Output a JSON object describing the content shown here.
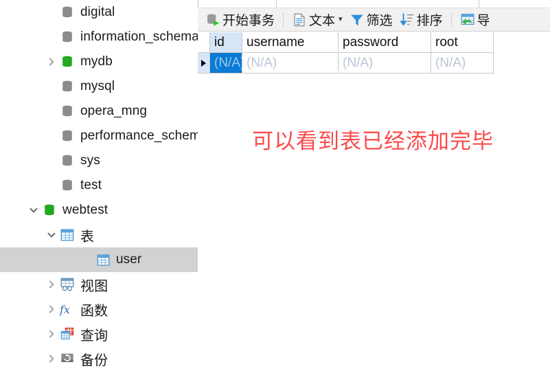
{
  "sidebar": {
    "items": [
      {
        "label": "digital",
        "icon": "database-icon",
        "state": "leaf",
        "indent": 2,
        "selected": false,
        "color": "gray"
      },
      {
        "label": "information_schema",
        "icon": "database-icon",
        "state": "leaf",
        "indent": 2,
        "selected": false,
        "color": "gray"
      },
      {
        "label": "mydb",
        "icon": "database-icon",
        "state": "collapsed",
        "indent": 2,
        "selected": false,
        "color": "green"
      },
      {
        "label": "mysql",
        "icon": "database-icon",
        "state": "leaf",
        "indent": 2,
        "selected": false,
        "color": "gray"
      },
      {
        "label": "opera_mng",
        "icon": "database-icon",
        "state": "leaf",
        "indent": 2,
        "selected": false,
        "color": "gray"
      },
      {
        "label": "performance_schema",
        "icon": "database-icon",
        "state": "leaf",
        "indent": 2,
        "selected": false,
        "color": "gray"
      },
      {
        "label": "sys",
        "icon": "database-icon",
        "state": "leaf",
        "indent": 2,
        "selected": false,
        "color": "gray"
      },
      {
        "label": "test",
        "icon": "database-icon",
        "state": "leaf",
        "indent": 2,
        "selected": false,
        "color": "gray"
      },
      {
        "label": "webtest",
        "icon": "database-icon",
        "state": "expanded",
        "indent": 1,
        "selected": false,
        "color": "green"
      },
      {
        "label": "表",
        "icon": "table-folder-icon",
        "state": "expanded",
        "indent": 2,
        "selected": false,
        "color": "blue"
      },
      {
        "label": "user",
        "icon": "table-icon",
        "state": "leaf",
        "indent": 4,
        "selected": true,
        "color": "blue"
      },
      {
        "label": "视图",
        "icon": "view-icon",
        "state": "collapsed",
        "indent": 2,
        "selected": false,
        "color": "blue"
      },
      {
        "label": "函数",
        "icon": "function-fx-icon",
        "state": "collapsed",
        "indent": 2,
        "selected": false,
        "color": "blue"
      },
      {
        "label": "查询",
        "icon": "query-icon",
        "state": "collapsed",
        "indent": 2,
        "selected": false,
        "color": "blue"
      },
      {
        "label": "备份",
        "icon": "backup-icon",
        "state": "collapsed",
        "indent": 2,
        "selected": false,
        "color": "gray"
      }
    ]
  },
  "toolbar": {
    "buttons": [
      {
        "label": "开始事务",
        "icon": "begin-transaction-icon",
        "caret": false
      },
      {
        "label": "文本",
        "icon": "text-document-icon",
        "caret": true
      },
      {
        "label": "筛选",
        "icon": "filter-funnel-icon",
        "caret": false
      },
      {
        "label": "排序",
        "icon": "sort-descending-icon",
        "caret": false
      },
      {
        "label": "导",
        "icon": "import-table-icon",
        "caret": false
      }
    ]
  },
  "grid": {
    "columns": [
      "id",
      "username",
      "password",
      "root"
    ],
    "selected_column": "id",
    "rows": [
      {
        "cells": [
          "(N/A)",
          "(N/A)",
          "(N/A)",
          "(N/A)"
        ],
        "current": true
      }
    ]
  },
  "annotation": {
    "text": "可以看到表已经添加完毕",
    "color": "#fb4a4a"
  },
  "colors": {
    "selection_blue": "#0a7ad4",
    "column_header_blue": "#d6e6f7",
    "tree_selection_gray": "#d2d2d2",
    "toolbar_background": "#f1f1f1",
    "database_green": "#22aa22",
    "database_gray": "#8d8d8d",
    "annotation_red": "#fb4a4a"
  }
}
